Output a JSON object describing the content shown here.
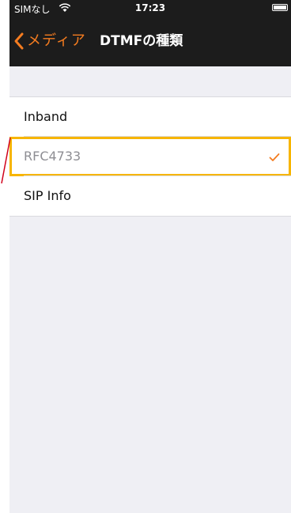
{
  "status_bar": {
    "carrier": "SIMなし",
    "time": "17:23"
  },
  "nav": {
    "back_label": "メディア",
    "title": "DTMFの種類"
  },
  "options": [
    {
      "label": "Inband",
      "selected": false
    },
    {
      "label": "RFC4733",
      "selected": true
    },
    {
      "label": "SIP Info",
      "selected": false
    }
  ],
  "colors": {
    "accent": "#f47c20",
    "highlight_border": "#f7b500",
    "annotation": "#d0021b"
  }
}
